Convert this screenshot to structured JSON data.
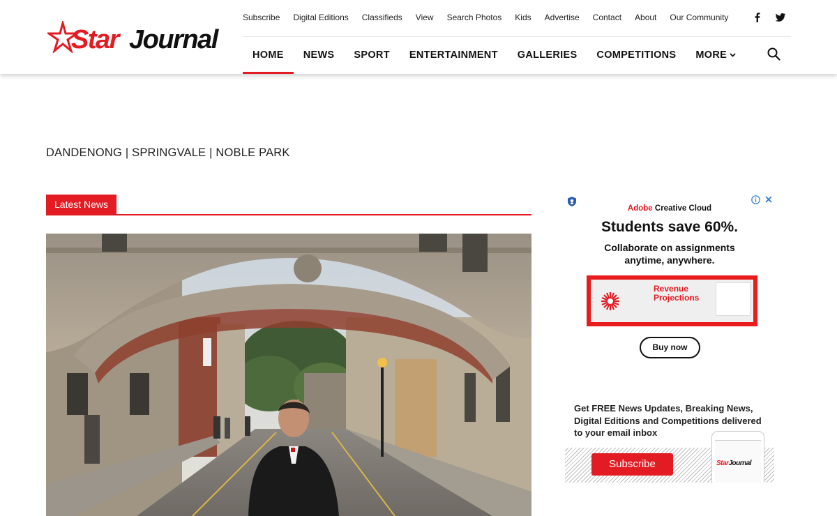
{
  "site": {
    "logo_star": "Star",
    "logo_journal": "Journal"
  },
  "topbar": [
    "Subscribe",
    "Digital Editions",
    "Classifieds",
    "View",
    "Search Photos",
    "Kids",
    "Advertise",
    "Contact",
    "About",
    "Our Community"
  ],
  "social": {
    "facebook_icon": "facebook-icon",
    "twitter_icon": "twitter-icon"
  },
  "nav": {
    "items": [
      "HOME",
      "NEWS",
      "SPORT",
      "ENTERTAINMENT",
      "GALLERIES",
      "COMPETITIONS",
      "MORE"
    ],
    "active": "HOME",
    "search_icon": "search-icon"
  },
  "locations": "DANDENONG | SPRINGVALE | NOBLE PARK",
  "section": {
    "title": "Latest News"
  },
  "ad": {
    "brand_adobe": "Adobe",
    "brand_product": "Creative Cloud",
    "headline": "Students save 60%.",
    "sub": "Collaborate on assignments anytime, anywhere.",
    "visual_title_1": "Revenue",
    "visual_title_2": "Projections",
    "cta": "Buy now"
  },
  "newsletter": {
    "text": "Get FREE News Updates, Breaking News, Digital Editions and Competitions delivered to your email inbox",
    "button": "Subscribe",
    "phone_logo_star": "Star",
    "phone_logo_journal": "Journal"
  },
  "colors": {
    "brand_red": "#e31b23",
    "text": "#111111"
  }
}
